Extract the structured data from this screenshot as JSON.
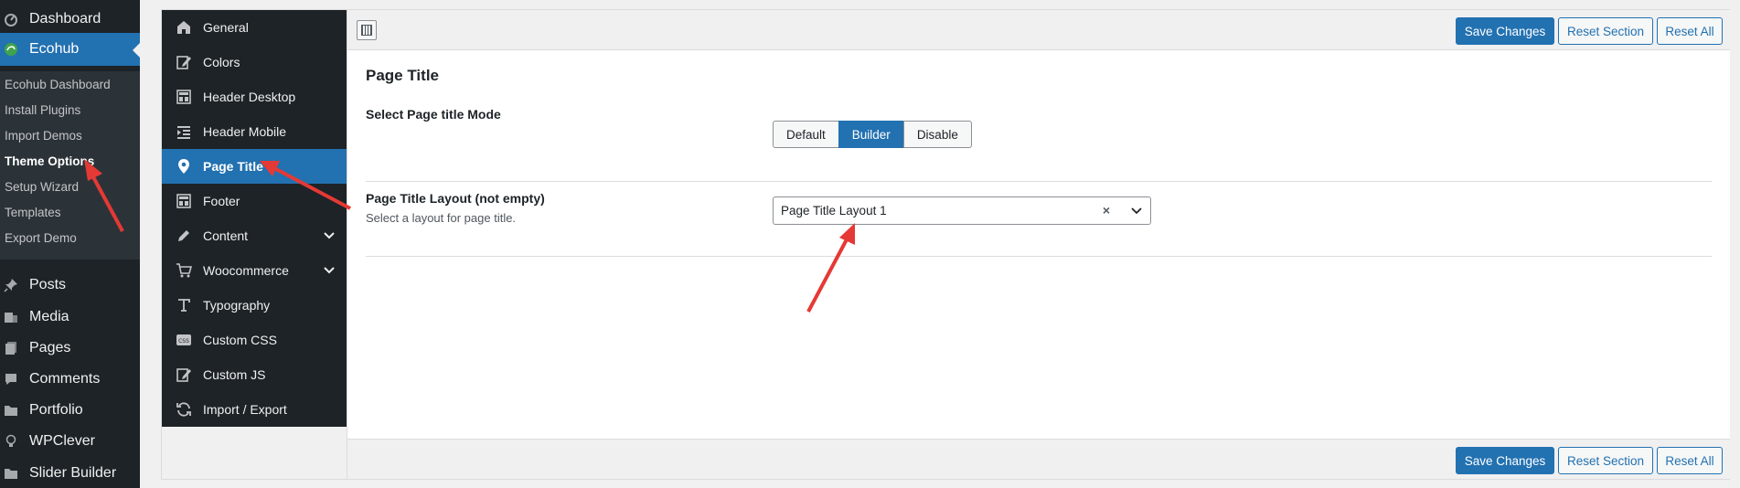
{
  "wp_menu": {
    "top_items": [
      {
        "label": "Dashboard",
        "icon": "dashboard-icon"
      },
      {
        "label": "Ecohub",
        "icon": "ecohub-icon",
        "active": true
      }
    ],
    "submenu": [
      {
        "label": "Ecohub Dashboard"
      },
      {
        "label": "Install Plugins"
      },
      {
        "label": "Import Demos"
      },
      {
        "label": "Theme Options",
        "current": true
      },
      {
        "label": "Setup Wizard"
      },
      {
        "label": "Templates"
      },
      {
        "label": "Export Demo"
      }
    ],
    "bottom_items": [
      {
        "label": "Posts",
        "icon": "pin-icon"
      },
      {
        "label": "Media",
        "icon": "media-icon"
      },
      {
        "label": "Pages",
        "icon": "pages-icon"
      },
      {
        "label": "Comments",
        "icon": "comment-icon"
      },
      {
        "label": "Portfolio",
        "icon": "folder-icon"
      },
      {
        "label": "WPClever",
        "icon": "bulb-icon"
      },
      {
        "label": "Slider Builder",
        "icon": "folder-icon"
      }
    ]
  },
  "options_nav": [
    {
      "label": "General",
      "icon": "home-icon"
    },
    {
      "label": "Colors",
      "icon": "edit-icon"
    },
    {
      "label": "Header Desktop",
      "icon": "layout-icon"
    },
    {
      "label": "Header Mobile",
      "icon": "indent-icon"
    },
    {
      "label": "Page Title",
      "icon": "location-pin-icon",
      "active": true
    },
    {
      "label": "Footer",
      "icon": "layout-icon"
    },
    {
      "label": "Content",
      "icon": "pencil-icon",
      "expandable": true
    },
    {
      "label": "Woocommerce",
      "icon": "cart-icon",
      "expandable": true
    },
    {
      "label": "Typography",
      "icon": "text-icon"
    },
    {
      "label": "Custom CSS",
      "icon": "css-icon"
    },
    {
      "label": "Custom JS",
      "icon": "edit-icon"
    },
    {
      "label": "Import / Export",
      "icon": "refresh-icon"
    }
  ],
  "toolbar": {
    "save_label": "Save Changes",
    "reset_section_label": "Reset Section",
    "reset_all_label": "Reset All"
  },
  "section": {
    "title": "Page Title",
    "mode_field": {
      "title": "Select Page title Mode",
      "options": [
        "Default",
        "Builder",
        "Disable"
      ],
      "selected": "Builder"
    },
    "layout_field": {
      "title": "Page Title Layout (not empty)",
      "description": "Select a layout for page title.",
      "value": "Page Title Layout 1",
      "clear_symbol": "×"
    }
  },
  "colors": {
    "accent": "#2271b1",
    "admin_bg": "#1d2327",
    "annotation": "#e53935"
  }
}
